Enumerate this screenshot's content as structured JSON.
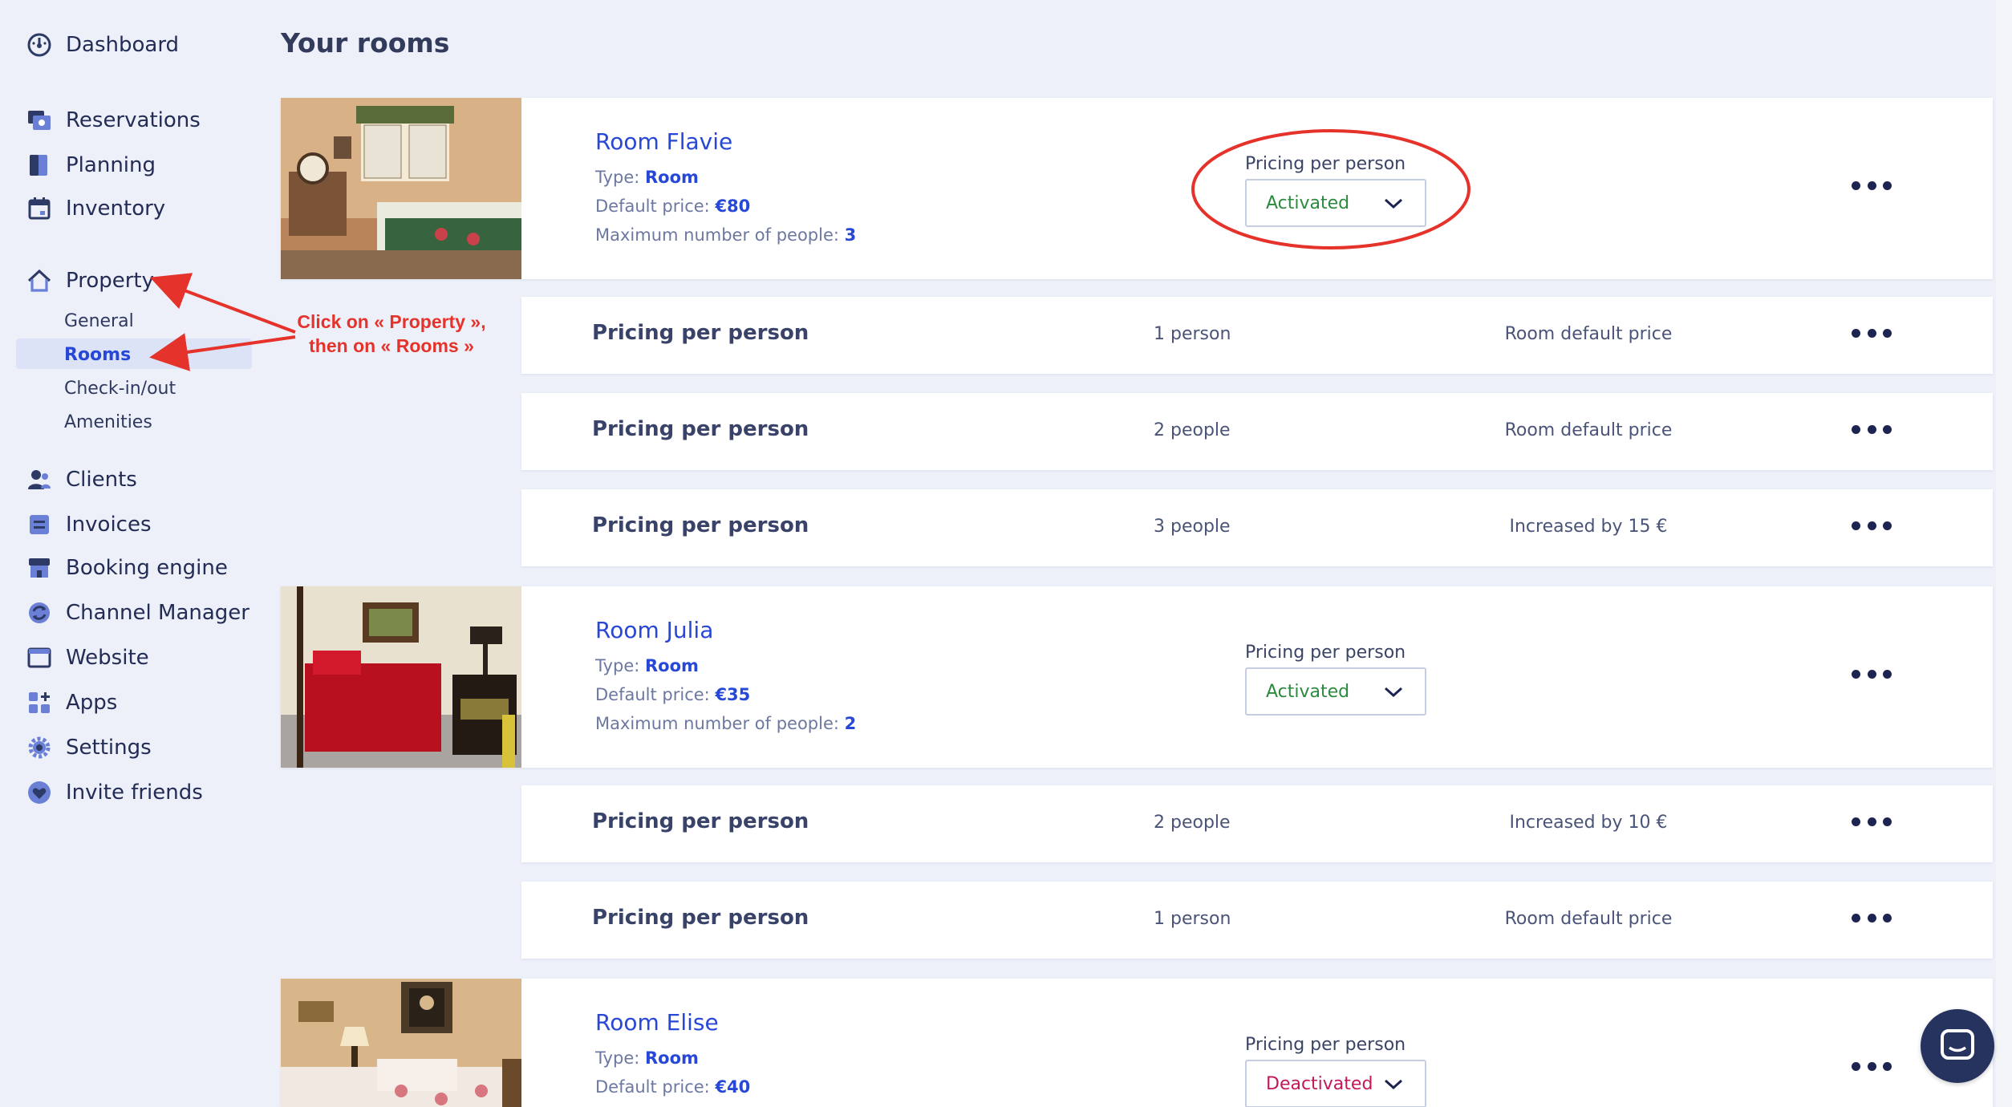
{
  "sidebar": {
    "items": [
      {
        "label": "Dashboard",
        "icon": "gauge-icon"
      },
      {
        "label": "Reservations",
        "icon": "reservations-icon"
      },
      {
        "label": "Planning",
        "icon": "book-icon"
      },
      {
        "label": "Inventory",
        "icon": "calendar-icon"
      },
      {
        "label": "Property",
        "icon": "home-icon"
      },
      {
        "label": "Clients",
        "icon": "users-icon"
      },
      {
        "label": "Invoices",
        "icon": "invoice-icon"
      },
      {
        "label": "Booking engine",
        "icon": "store-icon"
      },
      {
        "label": "Channel Manager",
        "icon": "sync-icon"
      },
      {
        "label": "Website",
        "icon": "browser-icon"
      },
      {
        "label": "Apps",
        "icon": "apps-icon"
      },
      {
        "label": "Settings",
        "icon": "gear-icon"
      },
      {
        "label": "Invite friends",
        "icon": "heart-icon"
      }
    ],
    "property_sub": [
      "General",
      "Rooms",
      "Check-in/out",
      "Amenities"
    ],
    "active_sub": "Rooms"
  },
  "main": {
    "title": "Your rooms",
    "type_label": "Type:",
    "default_price_label": "Default price:",
    "max_people_label": "Maximum number of people:",
    "pricing_label": "Pricing per person",
    "rooms": [
      {
        "name": "Room Flavie",
        "type": "Room",
        "default_price": "€80",
        "max_people": "3",
        "pricing_status": "Activated"
      },
      {
        "name": "Room Julia",
        "type": "Room",
        "default_price": "€35",
        "max_people": "2",
        "pricing_status": "Activated"
      },
      {
        "name": "Room Elise",
        "type": "Room",
        "default_price": "€40",
        "pricing_status": "Deactivated"
      }
    ],
    "price_rows": [
      {
        "title": "Pricing per person",
        "count": "1 person",
        "price": "Room default price"
      },
      {
        "title": "Pricing per person",
        "count": "2 people",
        "price": "Room default price"
      },
      {
        "title": "Pricing per person",
        "count": "3 people",
        "price": "Increased by 15 €"
      },
      {
        "title": "Pricing per person",
        "count": "2 people",
        "price": "Increased by 10 €"
      },
      {
        "title": "Pricing per person",
        "count": "1 person",
        "price": "Room default price"
      }
    ]
  },
  "annotation": {
    "line1": "Click on « Property »,",
    "line2": "then on « Rooms »",
    "color": "#e5322b"
  },
  "colors": {
    "accent": "#2747d6",
    "activated": "#2b8a3e",
    "deactivated": "#c2185b",
    "background": "#edf0f9"
  }
}
